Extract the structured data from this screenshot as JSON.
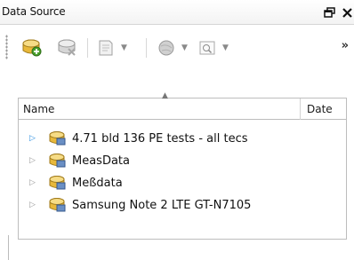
{
  "window": {
    "title": "Data Source"
  },
  "title_buttons": [
    {
      "name": "float-icon",
      "glyph": "🗗"
    },
    {
      "name": "close-icon",
      "glyph": "✕"
    }
  ],
  "toolbar": {
    "more_glyph": "»",
    "tools": [
      {
        "name": "add-datasource-button",
        "icon": "add-database-icon"
      },
      {
        "name": "remove-datasource-button",
        "icon": "remove-database-icon"
      },
      {
        "name": "page-dropdown-button",
        "icon": "page-icon",
        "dropdown": true
      },
      {
        "name": "globe-dropdown-button",
        "icon": "globe-icon",
        "dropdown": true
      },
      {
        "name": "search-dropdown-button",
        "icon": "search-icon",
        "dropdown": true
      }
    ]
  },
  "table": {
    "columns": [
      "Name",
      "Date"
    ],
    "rows": [
      {
        "label": "4.71 bld 136 PE tests - all tecs",
        "active": true
      },
      {
        "label": "MeasData",
        "active": false
      },
      {
        "label": "Meßdata",
        "active": false
      },
      {
        "label": "Samsung Note 2 LTE GT-N7105",
        "active": false
      }
    ]
  },
  "colors": {
    "accent": "#2d8fe0",
    "db_yellow": "#e8b83a",
    "db_blue": "#6a8fc4"
  }
}
